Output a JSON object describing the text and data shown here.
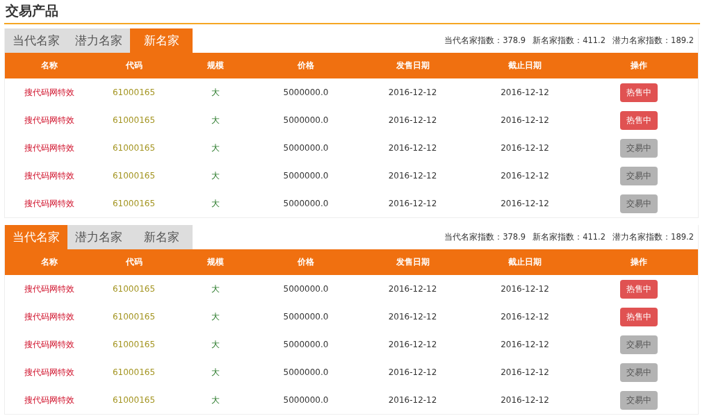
{
  "title": "交易产品",
  "panels": [
    {
      "tabs": [
        {
          "label": "当代名家",
          "selected": false
        },
        {
          "label": "潜力名家",
          "selected": false
        },
        {
          "label": "新名家",
          "selected": true
        }
      ],
      "stats": [
        "当代名家指数：378.9",
        "新名家指数：411.2",
        "潜力名家指数：189.2"
      ],
      "columns": [
        "名称",
        "代码",
        "规模",
        "价格",
        "发售日期",
        "截止日期",
        "操作"
      ],
      "rows": [
        {
          "name": "搜代码网特效",
          "code": "61000165",
          "scale": "大",
          "price": "5000000.0",
          "sale_date": "2016-12-12",
          "end_date": "2016-12-12",
          "action": {
            "label": "热售中",
            "kind": "hot"
          }
        },
        {
          "name": "搜代码网特效",
          "code": "61000165",
          "scale": "大",
          "price": "5000000.0",
          "sale_date": "2016-12-12",
          "end_date": "2016-12-12",
          "action": {
            "label": "热售中",
            "kind": "hot"
          }
        },
        {
          "name": "搜代码网特效",
          "code": "61000165",
          "scale": "大",
          "price": "5000000.0",
          "sale_date": "2016-12-12",
          "end_date": "2016-12-12",
          "action": {
            "label": "交易中",
            "kind": "trading"
          }
        },
        {
          "name": "搜代码网特效",
          "code": "61000165",
          "scale": "大",
          "price": "5000000.0",
          "sale_date": "2016-12-12",
          "end_date": "2016-12-12",
          "action": {
            "label": "交易中",
            "kind": "trading"
          }
        },
        {
          "name": "搜代码网特效",
          "code": "61000165",
          "scale": "大",
          "price": "5000000.0",
          "sale_date": "2016-12-12",
          "end_date": "2016-12-12",
          "action": {
            "label": "交易中",
            "kind": "trading"
          }
        }
      ]
    },
    {
      "tabs": [
        {
          "label": "当代名家",
          "selected": true
        },
        {
          "label": "潜力名家",
          "selected": false
        },
        {
          "label": "新名家",
          "selected": false
        }
      ],
      "stats": [
        "当代名家指数：378.9",
        "新名家指数：411.2",
        "潜力名家指数：189.2"
      ],
      "columns": [
        "名称",
        "代码",
        "规模",
        "价格",
        "发售日期",
        "截止日期",
        "操作"
      ],
      "rows": [
        {
          "name": "搜代码网特效",
          "code": "61000165",
          "scale": "大",
          "price": "5000000.0",
          "sale_date": "2016-12-12",
          "end_date": "2016-12-12",
          "action": {
            "label": "热售中",
            "kind": "hot"
          }
        },
        {
          "name": "搜代码网特效",
          "code": "61000165",
          "scale": "大",
          "price": "5000000.0",
          "sale_date": "2016-12-12",
          "end_date": "2016-12-12",
          "action": {
            "label": "热售中",
            "kind": "hot"
          }
        },
        {
          "name": "搜代码网特效",
          "code": "61000165",
          "scale": "大",
          "price": "5000000.0",
          "sale_date": "2016-12-12",
          "end_date": "2016-12-12",
          "action": {
            "label": "交易中",
            "kind": "trading"
          }
        },
        {
          "name": "搜代码网特效",
          "code": "61000165",
          "scale": "大",
          "price": "5000000.0",
          "sale_date": "2016-12-12",
          "end_date": "2016-12-12",
          "action": {
            "label": "交易中",
            "kind": "trading"
          }
        },
        {
          "name": "搜代码网特效",
          "code": "61000165",
          "scale": "大",
          "price": "5000000.0",
          "sale_date": "2016-12-12",
          "end_date": "2016-12-12",
          "action": {
            "label": "交易中",
            "kind": "trading"
          }
        }
      ]
    }
  ]
}
